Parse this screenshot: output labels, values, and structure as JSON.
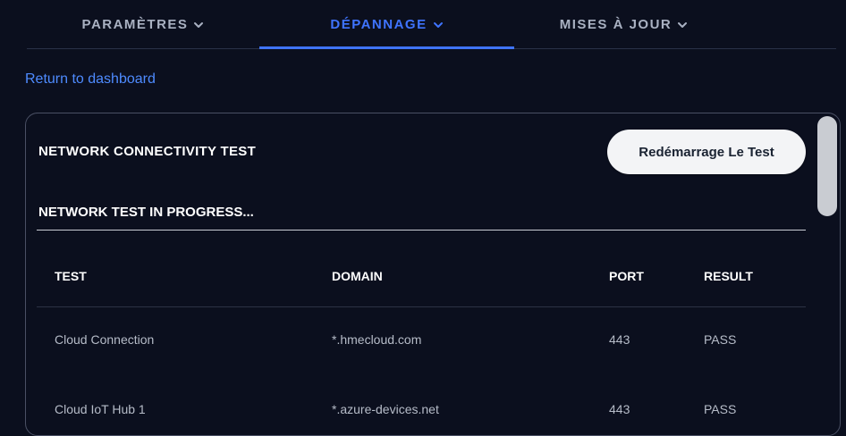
{
  "nav": {
    "tabs": [
      {
        "label": "PARAMÈTRES",
        "active": false
      },
      {
        "label": "DÉPANNAGE",
        "active": true
      },
      {
        "label": "MISES À JOUR",
        "active": false
      }
    ],
    "chevron_icon": "chevron-down-icon"
  },
  "return_link": "Return to dashboard",
  "card": {
    "title": "NETWORK CONNECTIVITY TEST",
    "restart_button": "Redémarrage Le Test",
    "progress_title": "NETWORK TEST IN PROGRESS...",
    "table": {
      "headers": [
        "TEST",
        "DOMAIN",
        "PORT",
        "RESULT"
      ],
      "rows": [
        [
          "Cloud Connection",
          "*.hmecloud.com",
          "443",
          "PASS"
        ],
        [
          "Cloud IoT Hub 1",
          "*.azure-devices.net",
          "443",
          "PASS"
        ]
      ]
    }
  },
  "colors": {
    "background": "#0b0f1e",
    "accent": "#3f74ff",
    "link": "#4e8bff",
    "tab_inactive": "#a9b1c2",
    "muted_text": "#b6bcc8",
    "button_bg": "#f3f4f6"
  }
}
